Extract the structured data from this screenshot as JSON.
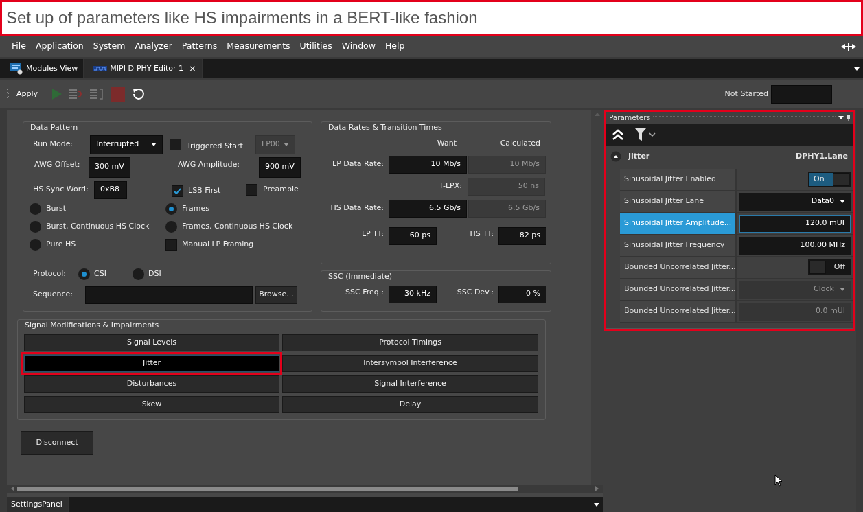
{
  "caption": {
    "text": "Set up of parameters like HS impairments in a BERT-like fashion"
  },
  "menu": [
    "File",
    "Application",
    "System",
    "Analyzer",
    "Patterns",
    "Measurements",
    "Utilities",
    "Window",
    "Help"
  ],
  "tabs": [
    {
      "label": "Modules View",
      "selected": false
    },
    {
      "label": "MIPI D-PHY Editor 1",
      "selected": true,
      "close": "×"
    }
  ],
  "toolbar": {
    "apply": "Apply",
    "status": "Not Started"
  },
  "data_pattern": {
    "title": "Data Pattern",
    "run_mode_label": "Run Mode:",
    "run_mode": "Interrupted",
    "triggered_start": {
      "label": "Triggered Start",
      "checked": false
    },
    "lp_state": "LP00",
    "awg_offset_label": "AWG Offset:",
    "awg_offset": "300 mV",
    "awg_amplitude_label": "AWG Amplitude:",
    "awg_amplitude": "900 mV",
    "hs_sync_word_label": "HS Sync Word:",
    "hs_sync_word": "0xB8",
    "lsb_first": {
      "label": "LSB First",
      "checked": true
    },
    "preamble": {
      "label": "Preamble",
      "checked": false
    },
    "modes": [
      {
        "kind": "radio",
        "label": "Burst",
        "selected": false
      },
      {
        "kind": "radio",
        "label": "Frames",
        "selected": true
      },
      {
        "kind": "radio",
        "label": "Burst, Continuous HS Clock",
        "selected": false
      },
      {
        "kind": "radio",
        "label": "Frames, Continuous HS Clock",
        "selected": false
      },
      {
        "kind": "radio",
        "label": "Pure HS",
        "selected": false
      },
      {
        "kind": "checkbox",
        "label": "Manual LP Framing",
        "checked": false
      }
    ],
    "protocol_label": "Protocol:",
    "protocols": [
      {
        "label": "CSI",
        "selected": true
      },
      {
        "label": "DSI",
        "selected": false
      }
    ],
    "sequence_label": "Sequence:",
    "browse": "Browse..."
  },
  "data_rates": {
    "title": "Data Rates & Transition Times",
    "headers": [
      "Want",
      "Calculated"
    ],
    "rows": [
      {
        "label": "LP Data Rate:",
        "want": "10 Mb/s",
        "calculated": "10 Mb/s"
      },
      {
        "label": "T-LPX:",
        "calculated": "50 ns"
      },
      {
        "label": "HS Data Rate:",
        "want": "6.5 Gb/s",
        "calculated": "6.5 Gb/s"
      }
    ],
    "transition_times": [
      {
        "label": "LP TT:",
        "value": "60 ps"
      },
      {
        "label": "HS TT:",
        "value": "82 ps"
      }
    ]
  },
  "ssc": {
    "title": "SSC (Immediate)",
    "fields": [
      {
        "label": "SSC Freq.:",
        "value": "30 kHz"
      },
      {
        "label": "SSC Dev.:",
        "value": "0 %"
      }
    ]
  },
  "signal_modifications": {
    "title": "Signal Modifications & Impairments",
    "buttons": [
      {
        "label": "Signal Levels",
        "selected": false,
        "highlighted": false
      },
      {
        "label": "Protocol Timings",
        "selected": false,
        "highlighted": false
      },
      {
        "label": "Jitter",
        "selected": true,
        "highlighted": true
      },
      {
        "label": "Intersymbol Interference",
        "selected": false,
        "highlighted": false
      },
      {
        "label": "Disturbances",
        "selected": false,
        "highlighted": false
      },
      {
        "label": "Signal Interference",
        "selected": false,
        "highlighted": false
      },
      {
        "label": "Skew",
        "selected": false,
        "highlighted": false
      },
      {
        "label": "Delay",
        "selected": false,
        "highlighted": false
      }
    ]
  },
  "disconnect": "Disconnect",
  "bottom_tab": "SettingsPanel",
  "parameters": {
    "title": "Parameters",
    "highlighted": true,
    "group": {
      "name": "Jitter",
      "target": "DPHY1.Lane",
      "expanded": true
    },
    "rows": [
      {
        "label": "Sinusoidal Jitter Enabled",
        "kind": "toggle",
        "value": "On",
        "on": true,
        "selected": false,
        "disabled": false
      },
      {
        "label": "Sinusoidal Jitter Lane",
        "kind": "dropdown",
        "value": "Data0",
        "selected": false,
        "disabled": false
      },
      {
        "label": "Sinusoidal Jitter Amplitude...",
        "kind": "number",
        "value": "120.0 mUI",
        "selected": true,
        "disabled": false
      },
      {
        "label": "Sinusoidal Jitter Frequency",
        "kind": "number",
        "value": "100.00 MHz",
        "selected": false,
        "disabled": false
      },
      {
        "label": "Bounded Uncorrelated Jitter...",
        "kind": "toggle",
        "value": "Off",
        "on": false,
        "selected": false,
        "disabled": false
      },
      {
        "label": "Bounded Uncorrelated Jitter...",
        "kind": "dropdown",
        "value": "Clock",
        "selected": false,
        "disabled": true
      },
      {
        "label": "Bounded Uncorrelated Jitter...",
        "kind": "number",
        "value": "0.0 mUI",
        "selected": false,
        "disabled": true
      }
    ]
  }
}
